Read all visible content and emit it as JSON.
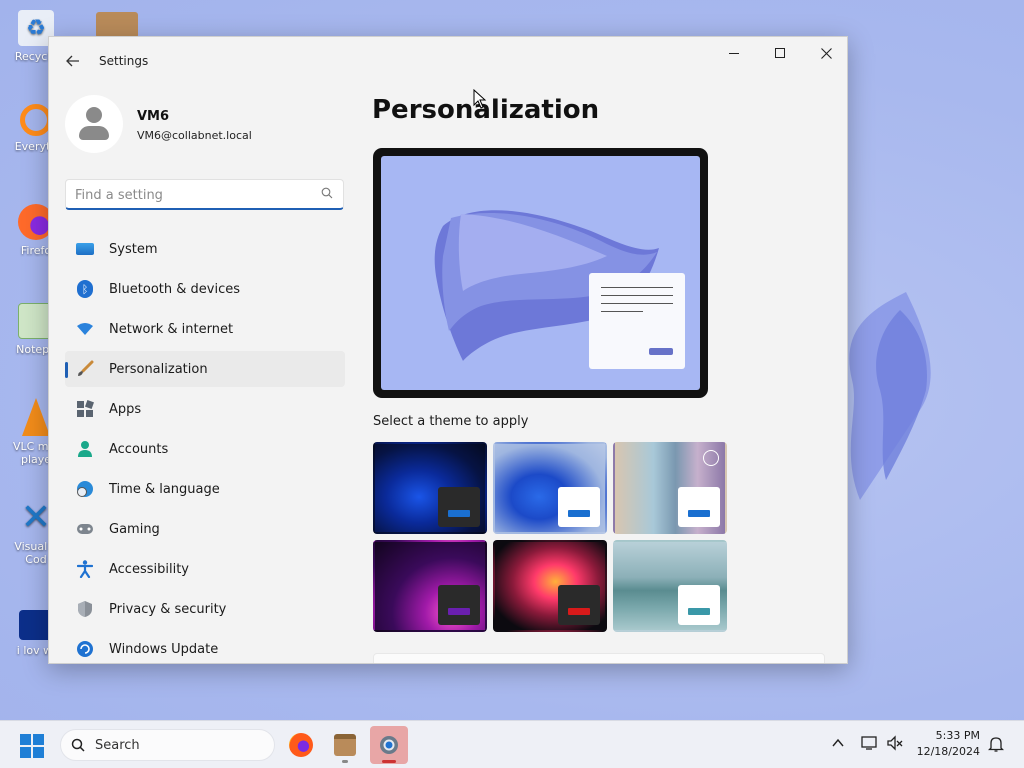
{
  "desktop": {
    "icons": [
      {
        "label": "Recycle",
        "color": "#e9eef7"
      },
      {
        "label": "Everyth",
        "color": "#ff8c1a"
      },
      {
        "label": "Firefo",
        "color": "#ff6a2a"
      },
      {
        "label": "Notepa",
        "color": "#cfe6c7"
      },
      {
        "label": "VLC m...\nplaye",
        "color": "#f28c1a"
      },
      {
        "label": "Visual S\nCod",
        "color": "#1f78c8"
      },
      {
        "label": "i lov wi",
        "color": "#0c2f8a"
      }
    ]
  },
  "window": {
    "title": "Settings",
    "back_icon": "back-arrow-icon",
    "controls": {
      "minimize": "—",
      "maximize": "☐",
      "close": "✕"
    }
  },
  "profile": {
    "name": "VM6",
    "email": "VM6@collabnet.local"
  },
  "search": {
    "placeholder": "Find a setting",
    "value": ""
  },
  "nav": {
    "items": [
      {
        "label": "System",
        "icon": "system-icon"
      },
      {
        "label": "Bluetooth & devices",
        "icon": "bluetooth-icon"
      },
      {
        "label": "Network & internet",
        "icon": "wifi-icon"
      },
      {
        "label": "Personalization",
        "icon": "brush-icon",
        "active": true
      },
      {
        "label": "Apps",
        "icon": "apps-icon"
      },
      {
        "label": "Accounts",
        "icon": "accounts-icon"
      },
      {
        "label": "Time & language",
        "icon": "globe-clock-icon"
      },
      {
        "label": "Gaming",
        "icon": "gamepad-icon"
      },
      {
        "label": "Accessibility",
        "icon": "accessibility-icon"
      },
      {
        "label": "Privacy & security",
        "icon": "shield-icon"
      },
      {
        "label": "Windows Update",
        "icon": "update-icon"
      }
    ]
  },
  "content": {
    "title": "Personalization",
    "theme_section_label": "Select a theme to apply",
    "themes": [
      {
        "name": "windows-dark",
        "accent": "#1a6fd0",
        "mini_bg": "#2a2a2a"
      },
      {
        "name": "windows-light",
        "accent": "#1a6fd0",
        "mini_bg": "#ffffff"
      },
      {
        "name": "windows-spotlight",
        "accent": "#1a6fd0",
        "mini_bg": "#ffffff",
        "slideshow": true
      },
      {
        "name": "glow",
        "accent": "#6a1fb0",
        "mini_bg": "#2a2a2a"
      },
      {
        "name": "captured-motion",
        "accent": "#d81a1a",
        "mini_bg": "#2a2a2a"
      },
      {
        "name": "flow",
        "accent": "#3a98a8",
        "mini_bg": "#ffffff"
      }
    ]
  },
  "taskbar": {
    "search_label": "Search",
    "time": "5:33 PM",
    "date": "12/18/2024"
  }
}
